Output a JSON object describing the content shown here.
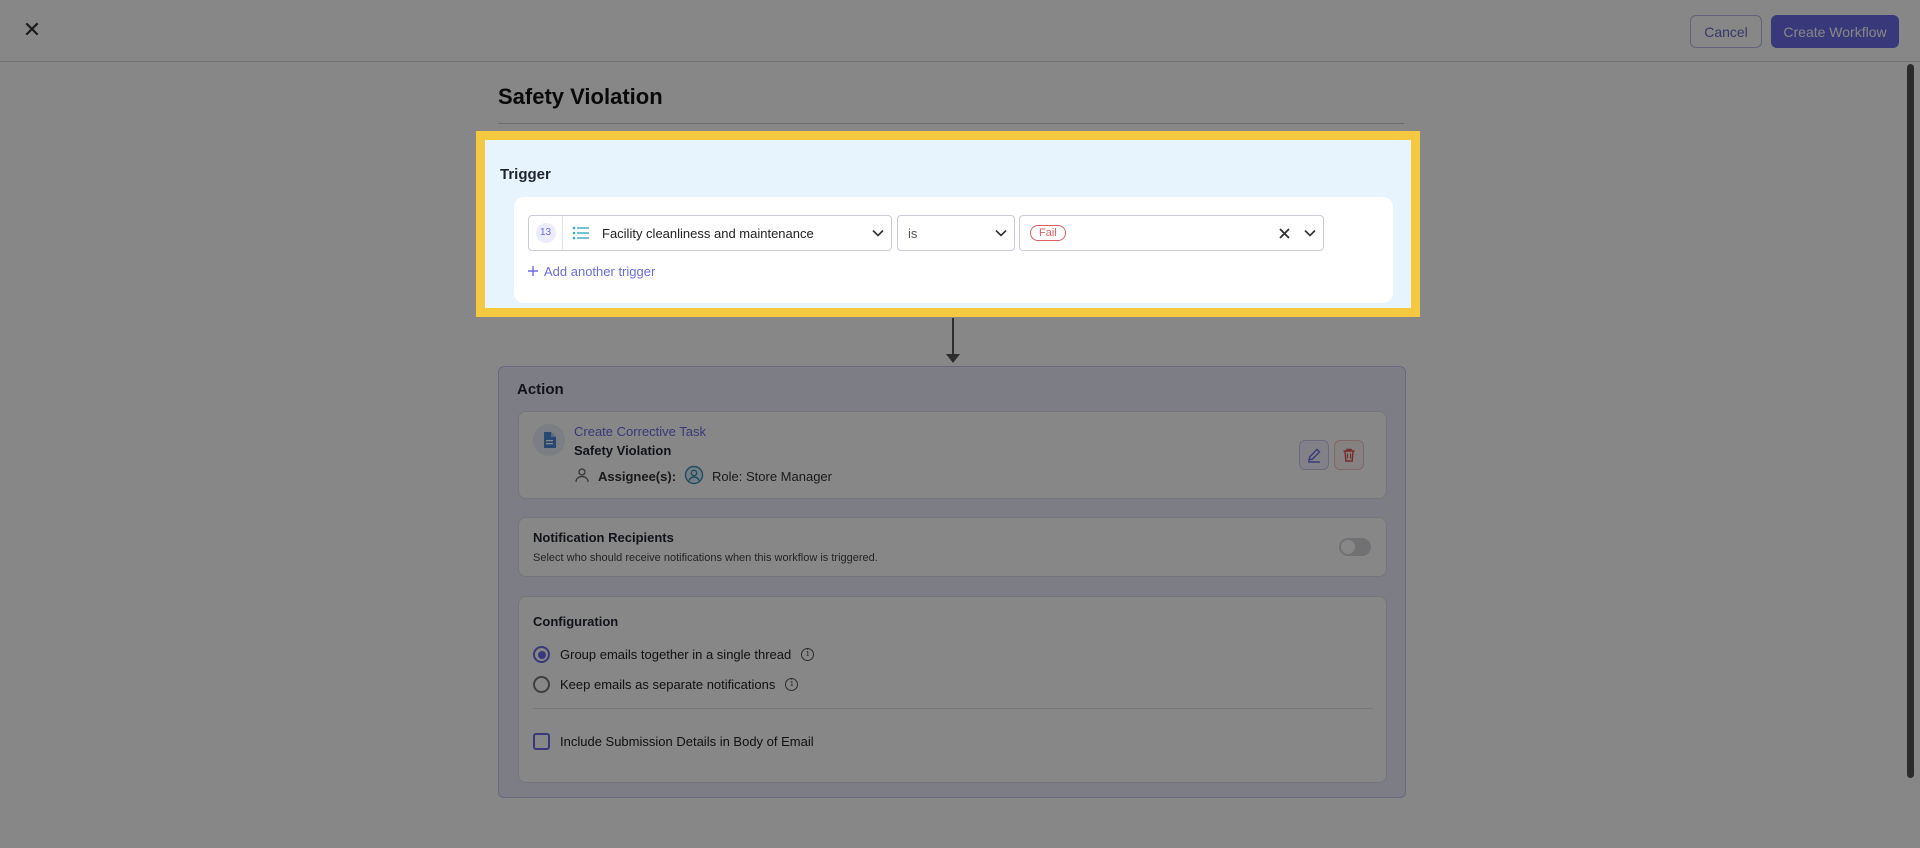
{
  "header": {
    "close_label": "✕",
    "cancel_label": "Cancel",
    "create_label": "Create Workflow"
  },
  "workflow": {
    "title": "Safety Violation"
  },
  "trigger": {
    "title": "Trigger",
    "question_number": "13",
    "question": "Facility cleanliness and maintenance",
    "operator": "is",
    "value": "Fail",
    "add_label": "Add another trigger"
  },
  "action": {
    "title": "Action",
    "task_type": "Create Corrective Task",
    "task_name": "Safety Violation",
    "assignee_label": "Assignee(s):",
    "assignee_value": "Role: Store Manager"
  },
  "notifications": {
    "title": "Notification Recipients",
    "subtitle": "Select who should receive notifications when this workflow is triggered.",
    "enabled": false
  },
  "configuration": {
    "title": "Configuration",
    "option_group": "Group emails together in a single thread",
    "option_separate": "Keep emails as separate notifications",
    "selected": "group",
    "include_details": "Include Submission Details in Body of Email",
    "include_checked": false
  },
  "colors": {
    "accent": "#6b6be6",
    "highlight": "#f5c842",
    "trigger_bg": "#e7f4fd",
    "danger": "#e06060"
  },
  "icons": [
    "close-icon",
    "list-icon",
    "chevron-down-icon",
    "clear-icon",
    "plus-icon",
    "document-icon",
    "person-icon",
    "role-icon",
    "edit-icon",
    "trash-icon",
    "info-icon"
  ]
}
